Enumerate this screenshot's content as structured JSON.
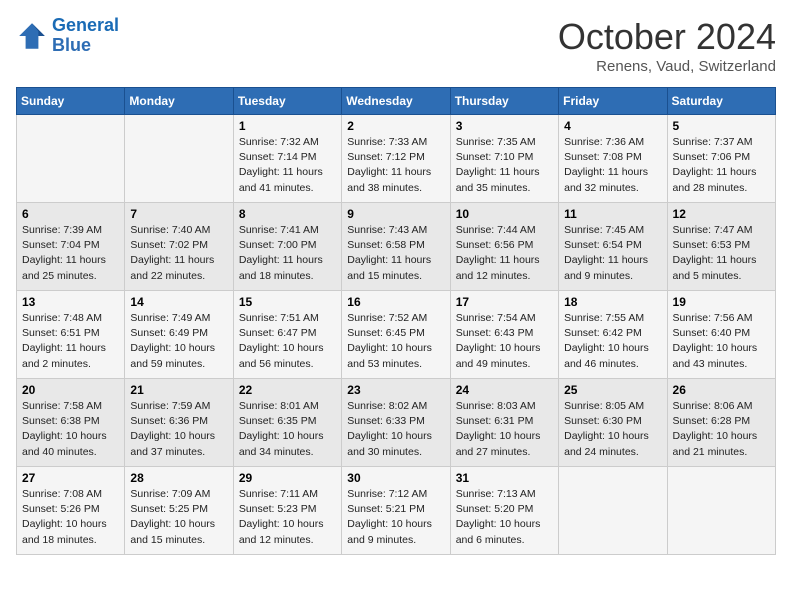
{
  "header": {
    "logo_line1": "General",
    "logo_line2": "Blue",
    "month": "October 2024",
    "location": "Renens, Vaud, Switzerland"
  },
  "days_of_week": [
    "Sunday",
    "Monday",
    "Tuesday",
    "Wednesday",
    "Thursday",
    "Friday",
    "Saturday"
  ],
  "weeks": [
    [
      {
        "num": "",
        "info": ""
      },
      {
        "num": "",
        "info": ""
      },
      {
        "num": "1",
        "info": "Sunrise: 7:32 AM\nSunset: 7:14 PM\nDaylight: 11 hours and 41 minutes."
      },
      {
        "num": "2",
        "info": "Sunrise: 7:33 AM\nSunset: 7:12 PM\nDaylight: 11 hours and 38 minutes."
      },
      {
        "num": "3",
        "info": "Sunrise: 7:35 AM\nSunset: 7:10 PM\nDaylight: 11 hours and 35 minutes."
      },
      {
        "num": "4",
        "info": "Sunrise: 7:36 AM\nSunset: 7:08 PM\nDaylight: 11 hours and 32 minutes."
      },
      {
        "num": "5",
        "info": "Sunrise: 7:37 AM\nSunset: 7:06 PM\nDaylight: 11 hours and 28 minutes."
      }
    ],
    [
      {
        "num": "6",
        "info": "Sunrise: 7:39 AM\nSunset: 7:04 PM\nDaylight: 11 hours and 25 minutes."
      },
      {
        "num": "7",
        "info": "Sunrise: 7:40 AM\nSunset: 7:02 PM\nDaylight: 11 hours and 22 minutes."
      },
      {
        "num": "8",
        "info": "Sunrise: 7:41 AM\nSunset: 7:00 PM\nDaylight: 11 hours and 18 minutes."
      },
      {
        "num": "9",
        "info": "Sunrise: 7:43 AM\nSunset: 6:58 PM\nDaylight: 11 hours and 15 minutes."
      },
      {
        "num": "10",
        "info": "Sunrise: 7:44 AM\nSunset: 6:56 PM\nDaylight: 11 hours and 12 minutes."
      },
      {
        "num": "11",
        "info": "Sunrise: 7:45 AM\nSunset: 6:54 PM\nDaylight: 11 hours and 9 minutes."
      },
      {
        "num": "12",
        "info": "Sunrise: 7:47 AM\nSunset: 6:53 PM\nDaylight: 11 hours and 5 minutes."
      }
    ],
    [
      {
        "num": "13",
        "info": "Sunrise: 7:48 AM\nSunset: 6:51 PM\nDaylight: 11 hours and 2 minutes."
      },
      {
        "num": "14",
        "info": "Sunrise: 7:49 AM\nSunset: 6:49 PM\nDaylight: 10 hours and 59 minutes."
      },
      {
        "num": "15",
        "info": "Sunrise: 7:51 AM\nSunset: 6:47 PM\nDaylight: 10 hours and 56 minutes."
      },
      {
        "num": "16",
        "info": "Sunrise: 7:52 AM\nSunset: 6:45 PM\nDaylight: 10 hours and 53 minutes."
      },
      {
        "num": "17",
        "info": "Sunrise: 7:54 AM\nSunset: 6:43 PM\nDaylight: 10 hours and 49 minutes."
      },
      {
        "num": "18",
        "info": "Sunrise: 7:55 AM\nSunset: 6:42 PM\nDaylight: 10 hours and 46 minutes."
      },
      {
        "num": "19",
        "info": "Sunrise: 7:56 AM\nSunset: 6:40 PM\nDaylight: 10 hours and 43 minutes."
      }
    ],
    [
      {
        "num": "20",
        "info": "Sunrise: 7:58 AM\nSunset: 6:38 PM\nDaylight: 10 hours and 40 minutes."
      },
      {
        "num": "21",
        "info": "Sunrise: 7:59 AM\nSunset: 6:36 PM\nDaylight: 10 hours and 37 minutes."
      },
      {
        "num": "22",
        "info": "Sunrise: 8:01 AM\nSunset: 6:35 PM\nDaylight: 10 hours and 34 minutes."
      },
      {
        "num": "23",
        "info": "Sunrise: 8:02 AM\nSunset: 6:33 PM\nDaylight: 10 hours and 30 minutes."
      },
      {
        "num": "24",
        "info": "Sunrise: 8:03 AM\nSunset: 6:31 PM\nDaylight: 10 hours and 27 minutes."
      },
      {
        "num": "25",
        "info": "Sunrise: 8:05 AM\nSunset: 6:30 PM\nDaylight: 10 hours and 24 minutes."
      },
      {
        "num": "26",
        "info": "Sunrise: 8:06 AM\nSunset: 6:28 PM\nDaylight: 10 hours and 21 minutes."
      }
    ],
    [
      {
        "num": "27",
        "info": "Sunrise: 7:08 AM\nSunset: 5:26 PM\nDaylight: 10 hours and 18 minutes."
      },
      {
        "num": "28",
        "info": "Sunrise: 7:09 AM\nSunset: 5:25 PM\nDaylight: 10 hours and 15 minutes."
      },
      {
        "num": "29",
        "info": "Sunrise: 7:11 AM\nSunset: 5:23 PM\nDaylight: 10 hours and 12 minutes."
      },
      {
        "num": "30",
        "info": "Sunrise: 7:12 AM\nSunset: 5:21 PM\nDaylight: 10 hours and 9 minutes."
      },
      {
        "num": "31",
        "info": "Sunrise: 7:13 AM\nSunset: 5:20 PM\nDaylight: 10 hours and 6 minutes."
      },
      {
        "num": "",
        "info": ""
      },
      {
        "num": "",
        "info": ""
      }
    ]
  ]
}
